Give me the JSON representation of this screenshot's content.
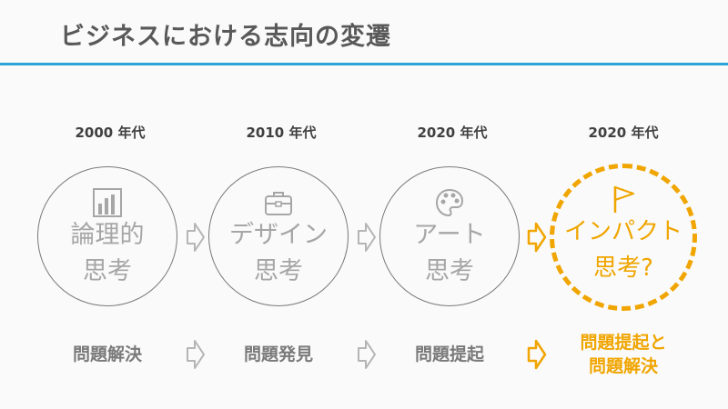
{
  "title": "ビジネスにおける志向の変遷",
  "stages": [
    {
      "era": "2000 年代",
      "line1": "論理的",
      "line2": "思考",
      "icon": "bar-chart-icon",
      "result1": "問題解決",
      "result2": ""
    },
    {
      "era": "2010 年代",
      "line1": "デザイン",
      "line2": "思考",
      "icon": "toolbox-icon",
      "result1": "問題発見",
      "result2": ""
    },
    {
      "era": "2020 年代",
      "line1": "アート",
      "line2": "思考",
      "icon": "palette-icon",
      "result1": "問題提起",
      "result2": ""
    },
    {
      "era": "2020 年代",
      "line1": "インパクト",
      "line2": "思考?",
      "icon": "flag-icon",
      "result1": "問題提起と",
      "result2": "問題解決"
    }
  ],
  "colors": {
    "accent": "#f0a500",
    "rule": "#2aa4d9",
    "muted": "#a6a6a6"
  }
}
